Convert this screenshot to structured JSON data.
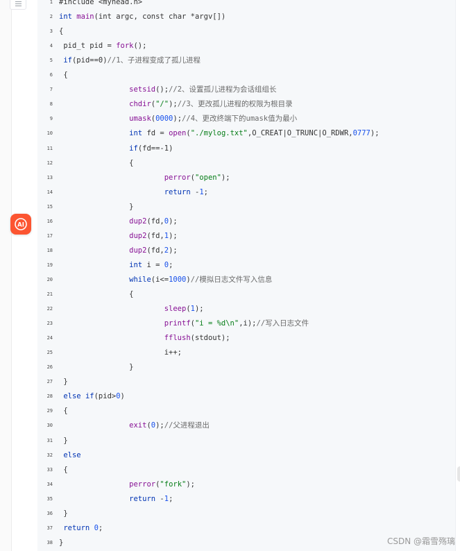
{
  "ai_button": {
    "label": "AI"
  },
  "watermark": "CSDN @霜雪殇璃",
  "colors": {
    "ai_button": "#fc5531",
    "code_background": "#f6f8fa",
    "keyword": "#0033b3",
    "function": "#871094",
    "string": "#067d17",
    "number": "#1750eb",
    "comment": "#6a6a6a"
  },
  "code": {
    "lines": [
      {
        "number": "1",
        "tokens": [
          {
            "text": "#include <myhead.h>",
            "type": "t"
          }
        ]
      },
      {
        "number": "2",
        "tokens": [
          {
            "text": "int",
            "type": "k"
          },
          {
            "text": " ",
            "type": "t"
          },
          {
            "text": "main",
            "type": "f"
          },
          {
            "text": "(int argc, const char *argv[])",
            "type": "t"
          }
        ]
      },
      {
        "number": "3",
        "tokens": [
          {
            "text": "{",
            "type": "t"
          }
        ]
      },
      {
        "number": "4",
        "tokens": [
          {
            "text": " pid_t pid = ",
            "type": "t"
          },
          {
            "text": "fork",
            "type": "f"
          },
          {
            "text": "();",
            "type": "t"
          }
        ]
      },
      {
        "number": "5",
        "tokens": [
          {
            "text": " ",
            "type": "t"
          },
          {
            "text": "if",
            "type": "k"
          },
          {
            "text": "(pid==0)",
            "type": "t"
          },
          {
            "text": "//1、子进程变成了孤儿进程",
            "type": "c"
          }
        ]
      },
      {
        "number": "6",
        "tokens": [
          {
            "text": " {",
            "type": "t"
          }
        ]
      },
      {
        "number": "7",
        "tokens": [
          {
            "text": "                ",
            "type": "t"
          },
          {
            "text": "setsid",
            "type": "f"
          },
          {
            "text": "();",
            "type": "t"
          },
          {
            "text": "//2、设置孤儿进程为会话组组长",
            "type": "c"
          }
        ]
      },
      {
        "number": "8",
        "tokens": [
          {
            "text": "                ",
            "type": "t"
          },
          {
            "text": "chdir",
            "type": "f"
          },
          {
            "text": "(",
            "type": "t"
          },
          {
            "text": "\"/\"",
            "type": "s"
          },
          {
            "text": ");",
            "type": "t"
          },
          {
            "text": "//3、更改孤儿进程的权限为根目录",
            "type": "c"
          }
        ]
      },
      {
        "number": "9",
        "tokens": [
          {
            "text": "                ",
            "type": "t"
          },
          {
            "text": "umask",
            "type": "f"
          },
          {
            "text": "(",
            "type": "t"
          },
          {
            "text": "0000",
            "type": "n"
          },
          {
            "text": ");",
            "type": "t"
          },
          {
            "text": "//4、更改终端下的umask值为最小",
            "type": "c"
          }
        ]
      },
      {
        "number": "10",
        "tokens": [
          {
            "text": "                ",
            "type": "t"
          },
          {
            "text": "int",
            "type": "k"
          },
          {
            "text": " fd = ",
            "type": "t"
          },
          {
            "text": "open",
            "type": "f"
          },
          {
            "text": "(",
            "type": "t"
          },
          {
            "text": "\"./mylog.txt\"",
            "type": "s"
          },
          {
            "text": ",O_CREAT|O_TRUNC|O_RDWR,",
            "type": "t"
          },
          {
            "text": "0777",
            "type": "n"
          },
          {
            "text": ");",
            "type": "t"
          }
        ]
      },
      {
        "number": "11",
        "tokens": [
          {
            "text": "                ",
            "type": "t"
          },
          {
            "text": "if",
            "type": "k"
          },
          {
            "text": "(fd==-1)",
            "type": "t"
          }
        ]
      },
      {
        "number": "12",
        "tokens": [
          {
            "text": "                {",
            "type": "t"
          }
        ]
      },
      {
        "number": "13",
        "tokens": [
          {
            "text": "                        ",
            "type": "t"
          },
          {
            "text": "perror",
            "type": "f"
          },
          {
            "text": "(",
            "type": "t"
          },
          {
            "text": "\"open\"",
            "type": "s"
          },
          {
            "text": ");",
            "type": "t"
          }
        ]
      },
      {
        "number": "14",
        "tokens": [
          {
            "text": "                        ",
            "type": "t"
          },
          {
            "text": "return",
            "type": "k"
          },
          {
            "text": " -",
            "type": "t"
          },
          {
            "text": "1",
            "type": "n"
          },
          {
            "text": ";",
            "type": "t"
          }
        ]
      },
      {
        "number": "15",
        "tokens": [
          {
            "text": "                }",
            "type": "t"
          }
        ]
      },
      {
        "number": "16",
        "tokens": [
          {
            "text": "                ",
            "type": "t"
          },
          {
            "text": "dup2",
            "type": "f"
          },
          {
            "text": "(fd,",
            "type": "t"
          },
          {
            "text": "0",
            "type": "n"
          },
          {
            "text": ");",
            "type": "t"
          }
        ]
      },
      {
        "number": "17",
        "tokens": [
          {
            "text": "                ",
            "type": "t"
          },
          {
            "text": "dup2",
            "type": "f"
          },
          {
            "text": "(fd,",
            "type": "t"
          },
          {
            "text": "1",
            "type": "n"
          },
          {
            "text": ");",
            "type": "t"
          }
        ]
      },
      {
        "number": "18",
        "tokens": [
          {
            "text": "                ",
            "type": "t"
          },
          {
            "text": "dup2",
            "type": "f"
          },
          {
            "text": "(fd,",
            "type": "t"
          },
          {
            "text": "2",
            "type": "n"
          },
          {
            "text": ");",
            "type": "t"
          }
        ]
      },
      {
        "number": "19",
        "tokens": [
          {
            "text": "                ",
            "type": "t"
          },
          {
            "text": "int",
            "type": "k"
          },
          {
            "text": " i = ",
            "type": "t"
          },
          {
            "text": "0",
            "type": "n"
          },
          {
            "text": ";",
            "type": "t"
          }
        ]
      },
      {
        "number": "20",
        "tokens": [
          {
            "text": "                ",
            "type": "t"
          },
          {
            "text": "while",
            "type": "k"
          },
          {
            "text": "(i<=",
            "type": "t"
          },
          {
            "text": "1000",
            "type": "n"
          },
          {
            "text": ")",
            "type": "t"
          },
          {
            "text": "//模拟日志文件写入信息",
            "type": "c"
          }
        ]
      },
      {
        "number": "21",
        "tokens": [
          {
            "text": "                {",
            "type": "t"
          }
        ]
      },
      {
        "number": "22",
        "tokens": [
          {
            "text": "                        ",
            "type": "t"
          },
          {
            "text": "sleep",
            "type": "f"
          },
          {
            "text": "(",
            "type": "t"
          },
          {
            "text": "1",
            "type": "n"
          },
          {
            "text": ");",
            "type": "t"
          }
        ]
      },
      {
        "number": "23",
        "tokens": [
          {
            "text": "                        ",
            "type": "t"
          },
          {
            "text": "printf",
            "type": "f"
          },
          {
            "text": "(",
            "type": "t"
          },
          {
            "text": "\"i = %d\\n\"",
            "type": "s"
          },
          {
            "text": ",i);",
            "type": "t"
          },
          {
            "text": "//写入日志文件",
            "type": "c"
          }
        ]
      },
      {
        "number": "24",
        "tokens": [
          {
            "text": "                        ",
            "type": "t"
          },
          {
            "text": "fflush",
            "type": "f"
          },
          {
            "text": "(stdout);",
            "type": "t"
          }
        ]
      },
      {
        "number": "25",
        "tokens": [
          {
            "text": "                        i++;",
            "type": "t"
          }
        ]
      },
      {
        "number": "26",
        "tokens": [
          {
            "text": "                }",
            "type": "t"
          }
        ]
      },
      {
        "number": "27",
        "tokens": [
          {
            "text": " }",
            "type": "t"
          }
        ]
      },
      {
        "number": "28",
        "tokens": [
          {
            "text": " ",
            "type": "t"
          },
          {
            "text": "else",
            "type": "k"
          },
          {
            "text": " ",
            "type": "t"
          },
          {
            "text": "if",
            "type": "k"
          },
          {
            "text": "(pid>",
            "type": "t"
          },
          {
            "text": "0",
            "type": "n"
          },
          {
            "text": ")",
            "type": "t"
          }
        ]
      },
      {
        "number": "29",
        "tokens": [
          {
            "text": " {",
            "type": "t"
          }
        ]
      },
      {
        "number": "30",
        "tokens": [
          {
            "text": "                ",
            "type": "t"
          },
          {
            "text": "exit",
            "type": "f"
          },
          {
            "text": "(",
            "type": "t"
          },
          {
            "text": "0",
            "type": "n"
          },
          {
            "text": ");",
            "type": "t"
          },
          {
            "text": "//父进程退出",
            "type": "c"
          }
        ]
      },
      {
        "number": "31",
        "tokens": [
          {
            "text": " }",
            "type": "t"
          }
        ]
      },
      {
        "number": "32",
        "tokens": [
          {
            "text": " ",
            "type": "t"
          },
          {
            "text": "else",
            "type": "k"
          }
        ]
      },
      {
        "number": "33",
        "tokens": [
          {
            "text": " {",
            "type": "t"
          }
        ]
      },
      {
        "number": "34",
        "tokens": [
          {
            "text": "                ",
            "type": "t"
          },
          {
            "text": "perror",
            "type": "f"
          },
          {
            "text": "(",
            "type": "t"
          },
          {
            "text": "\"fork\"",
            "type": "s"
          },
          {
            "text": ");",
            "type": "t"
          }
        ]
      },
      {
        "number": "35",
        "tokens": [
          {
            "text": "                ",
            "type": "t"
          },
          {
            "text": "return",
            "type": "k"
          },
          {
            "text": " -",
            "type": "t"
          },
          {
            "text": "1",
            "type": "n"
          },
          {
            "text": ";",
            "type": "t"
          }
        ]
      },
      {
        "number": "36",
        "tokens": [
          {
            "text": " }",
            "type": "t"
          }
        ]
      },
      {
        "number": "37",
        "tokens": [
          {
            "text": " ",
            "type": "t"
          },
          {
            "text": "return",
            "type": "k"
          },
          {
            "text": " ",
            "type": "t"
          },
          {
            "text": "0",
            "type": "n"
          },
          {
            "text": ";",
            "type": "t"
          }
        ]
      },
      {
        "number": "38",
        "tokens": [
          {
            "text": "}",
            "type": "t"
          }
        ]
      }
    ]
  }
}
